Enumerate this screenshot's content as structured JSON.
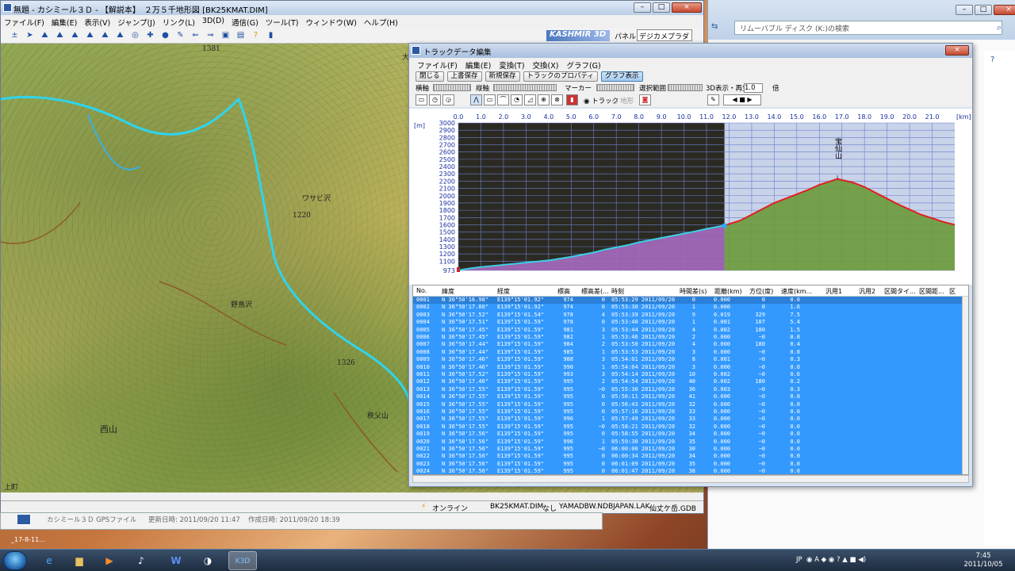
{
  "main": {
    "title": "無題 - カシミール３Ｄ - 【解説本】　２万５千地形図 [BK25KMAT.DIM]",
    "menu": [
      "ファイル(F)",
      "編集(E)",
      "表示(V)",
      "ジャンプ(J)",
      "リンク(L)",
      "3D(D)",
      "通信(G)",
      "ツール(T)",
      "ウィンドウ(W)",
      "ヘルプ(H)"
    ],
    "logo": "KASHMIR 3D",
    "panel_label": "パネル",
    "panel_value": "デジカメプラダイ",
    "map_labels": [
      "ワサビ沢",
      "西山",
      "1220",
      "1326",
      "1381",
      "大",
      "秩父山",
      "野鳥沢",
      "上町"
    ],
    "status": {
      "online": "オンライン",
      "map": "BK25KMAT.DIM",
      "none": "なし",
      "ndb": "YAMADBW.NDB",
      "lak": "JAPAN.LAK",
      "gdb": "仙丈ケ岳.GDB"
    },
    "gps_window": {
      "name": "カシミール３Ｄ GPSファイル",
      "updated": "更新日時: 2011/09/20 11:47",
      "created": "作成日時: 2011/09/20 18:39"
    }
  },
  "explorer": {
    "search_placeholder": "リムーバブル ディスク (K:)の検索"
  },
  "track": {
    "title": "トラックデータ編集",
    "menu": [
      "ファイル(F)",
      "編集(E)",
      "変換(T)",
      "交換(X)",
      "グラフ(G)"
    ],
    "buttons": [
      "閉じる",
      "上書保存",
      "新規保存",
      "トラックのプロパティ",
      "グラフ表示"
    ],
    "labels": {
      "yoko": "横軸",
      "tate": "縦軸",
      "marker": "マーカー",
      "range": "選択範囲",
      "play": "3D表示・再生",
      "speed": "1.0",
      "bai": "倍",
      "track_radio": "トラック",
      "terrain_radio": "地形"
    },
    "headers": [
      "No.",
      "緯度",
      "経度",
      "標高",
      "標高差(...",
      "時刻",
      "時間差(s)",
      "距離(km)",
      "方位(度)",
      "速度(km...",
      "汎用1",
      "汎用2",
      "区間タイ...",
      "区間距...",
      "区"
    ],
    "rows": [
      [
        "0001",
        "N 36°50'16.98\"",
        "E139°15'01.92\"",
        "974",
        "0",
        "05:53:29 2011/09/20",
        "0",
        "0.000",
        "0",
        "0.0"
      ],
      [
        "0002",
        "N 36°50'17.00\"",
        "E139°15'01.92\"",
        "974",
        "0",
        "05:53:30 2011/09/20",
        "1",
        "0.000",
        "0",
        "1.6"
      ],
      [
        "0003",
        "N 36°50'17.52\"",
        "E139°15'01.54\"",
        "978",
        "4",
        "05:53:39 2011/09/20",
        "9",
        "0.019",
        "329",
        "7.5"
      ],
      [
        "0004",
        "N 36°50'17.51\"",
        "E139°15'01.59\"",
        "978",
        "0",
        "05:53:40 2011/09/20",
        "1",
        "0.001",
        "107",
        "5.4"
      ],
      [
        "0005",
        "N 36°50'17.45\"",
        "E139°15'01.59\"",
        "981",
        "3",
        "05:53:44 2011/09/20",
        "4",
        "0.002",
        "180",
        "1.5"
      ],
      [
        "0006",
        "N 36°50'17.45\"",
        "E139°15'01.59\"",
        "982",
        "1",
        "05:53:46 2011/09/20",
        "2",
        "0.000",
        "−0",
        "0.0"
      ],
      [
        "0007",
        "N 36°50'17.44\"",
        "E139°15'01.59\"",
        "984",
        "2",
        "05:53:50 2011/09/20",
        "4",
        "0.000",
        "180",
        "0.4"
      ],
      [
        "0008",
        "N 36°50'17.44\"",
        "E139°15'01.59\"",
        "985",
        "1",
        "05:53:53 2011/09/20",
        "3",
        "0.000",
        "−0",
        "0.0"
      ],
      [
        "0009",
        "N 36°50'17.46\"",
        "E139°15'01.59\"",
        "988",
        "3",
        "05:54:01 2011/09/20",
        "8",
        "0.001",
        "−0",
        "0.3"
      ],
      [
        "0010",
        "N 36°50'17.46\"",
        "E139°15'01.59\"",
        "990",
        "1",
        "05:54:04 2011/09/20",
        "3",
        "0.000",
        "−0",
        "0.0"
      ],
      [
        "0011",
        "N 36°50'17.52\"",
        "E139°15'01.59\"",
        "993",
        "3",
        "05:54:14 2011/09/20",
        "10",
        "0.002",
        "−0",
        "0.6"
      ],
      [
        "0012",
        "N 36°50'17.46\"",
        "E139°15'01.59\"",
        "995",
        "2",
        "05:54:54 2011/09/20",
        "40",
        "0.002",
        "180",
        "0.2"
      ],
      [
        "0013",
        "N 36°50'17.55\"",
        "E139°15'01.59\"",
        "995",
        "−0",
        "05:55:30 2011/09/20",
        "36",
        "0.003",
        "−0",
        "0.3"
      ],
      [
        "0014",
        "N 36°50'17.55\"",
        "E139°15'01.59\"",
        "995",
        "0",
        "05:56:11 2011/09/20",
        "41",
        "0.000",
        "−0",
        "0.0"
      ],
      [
        "0015",
        "N 36°50'17.55\"",
        "E139°15'01.59\"",
        "995",
        "0",
        "05:56:43 2011/09/20",
        "32",
        "0.000",
        "−0",
        "0.0"
      ],
      [
        "0016",
        "N 36°50'17.55\"",
        "E139°15'01.59\"",
        "995",
        "0",
        "05:57:16 2011/09/20",
        "33",
        "0.000",
        "−0",
        "0.0"
      ],
      [
        "0017",
        "N 36°50'17.55\"",
        "E139°15'01.59\"",
        "996",
        "1",
        "05:57:49 2011/09/20",
        "33",
        "0.000",
        "−0",
        "0.0"
      ],
      [
        "0018",
        "N 36°50'17.55\"",
        "E139°15'01.59\"",
        "995",
        "−0",
        "05:58:21 2011/09/20",
        "32",
        "0.000",
        "−0",
        "0.0"
      ],
      [
        "0019",
        "N 36°50'17.56\"",
        "E139°15'01.59\"",
        "995",
        "0",
        "05:58:55 2011/09/20",
        "34",
        "0.000",
        "−0",
        "0.0"
      ],
      [
        "0020",
        "N 36°50'17.56\"",
        "E139°15'01.59\"",
        "996",
        "1",
        "05:59:30 2011/09/20",
        "35",
        "0.000",
        "−0",
        "0.0"
      ],
      [
        "0021",
        "N 36°50'17.56\"",
        "E139°15'01.59\"",
        "995",
        "−0",
        "06:00:00 2011/09/20",
        "30",
        "0.000",
        "−0",
        "0.0"
      ],
      [
        "0022",
        "N 36°50'17.56\"",
        "E139°15'01.59\"",
        "995",
        "0",
        "06:00:34 2011/09/20",
        "34",
        "0.000",
        "−0",
        "0.0"
      ],
      [
        "0023",
        "N 36°50'17.56\"",
        "E139°15'01.59\"",
        "995",
        "0",
        "06:01:09 2011/09/20",
        "35",
        "0.000",
        "−0",
        "0.0"
      ],
      [
        "0024",
        "N 36°50'17.56\"",
        "E139°15'01.59\"",
        "995",
        "0",
        "06:01:47 2011/09/20",
        "38",
        "0.000",
        "−0",
        "0.0"
      ]
    ]
  },
  "taskbar": {
    "time": "7:45",
    "date": "2011/10/05",
    "lang": "JP",
    "desktop_label": "_17-8-11..."
  },
  "colors": {
    "chart_plot_bg_dark": "#2b2a22",
    "chart_plot_bg_light": "#c8d2e8",
    "elevation_fill_purple": "#a66ac0",
    "elevation_fill_green": "#6a9a3a",
    "track_line_cyan": "#3ad0e6",
    "track_line_red": "#e02020",
    "list_selection": "#3399ff"
  },
  "chart_data": {
    "type": "area",
    "title": "",
    "xlabel": "[km]",
    "ylabel": "[m]",
    "x_ticks": [
      0.0,
      1.0,
      2.0,
      3.0,
      4.0,
      5.0,
      6.0,
      7.0,
      8.0,
      9.0,
      10.0,
      11.0,
      12.0,
      13.0,
      14.0,
      15.0,
      16.0,
      17.0,
      18.0,
      19.0,
      20.0,
      21.0
    ],
    "y_ticks": [
      973,
      1100,
      1200,
      1300,
      1400,
      1500,
      1600,
      1700,
      1800,
      1900,
      2000,
      2100,
      2200,
      2300,
      2400,
      2500,
      2600,
      2700,
      2800,
      2900,
      3000
    ],
    "xlim": [
      0,
      22.0
    ],
    "ylim": [
      973,
      3000
    ],
    "marker_label": "宝仙山",
    "marker_x": 16.8,
    "split_x": 11.8,
    "series": [
      {
        "x": [
          0,
          0.5,
          1,
          1.5,
          2,
          2.5,
          3,
          3.5,
          4,
          4.5,
          5,
          5.5,
          6,
          6.5,
          7,
          7.5,
          8,
          8.5,
          9,
          9.5,
          10,
          10.5,
          11,
          11.8
        ],
        "values": [
          975,
          1000,
          1020,
          1035,
          1050,
          1065,
          1080,
          1095,
          1110,
          1135,
          1160,
          1190,
          1220,
          1260,
          1290,
          1320,
          1360,
          1390,
          1420,
          1450,
          1480,
          1510,
          1545,
          1590
        ]
      },
      {
        "x": [
          11.8,
          12.5,
          13,
          13.5,
          14,
          14.5,
          15,
          15.5,
          16,
          16.5,
          16.8,
          17,
          17.5,
          18,
          18.5,
          19,
          19.5,
          20,
          20.5,
          21,
          21.5,
          22
        ],
        "values": [
          1590,
          1660,
          1740,
          1820,
          1900,
          1960,
          2020,
          2080,
          2150,
          2200,
          2230,
          2215,
          2180,
          2120,
          2040,
          1960,
          1880,
          1810,
          1740,
          1690,
          1640,
          1600
        ]
      }
    ]
  }
}
